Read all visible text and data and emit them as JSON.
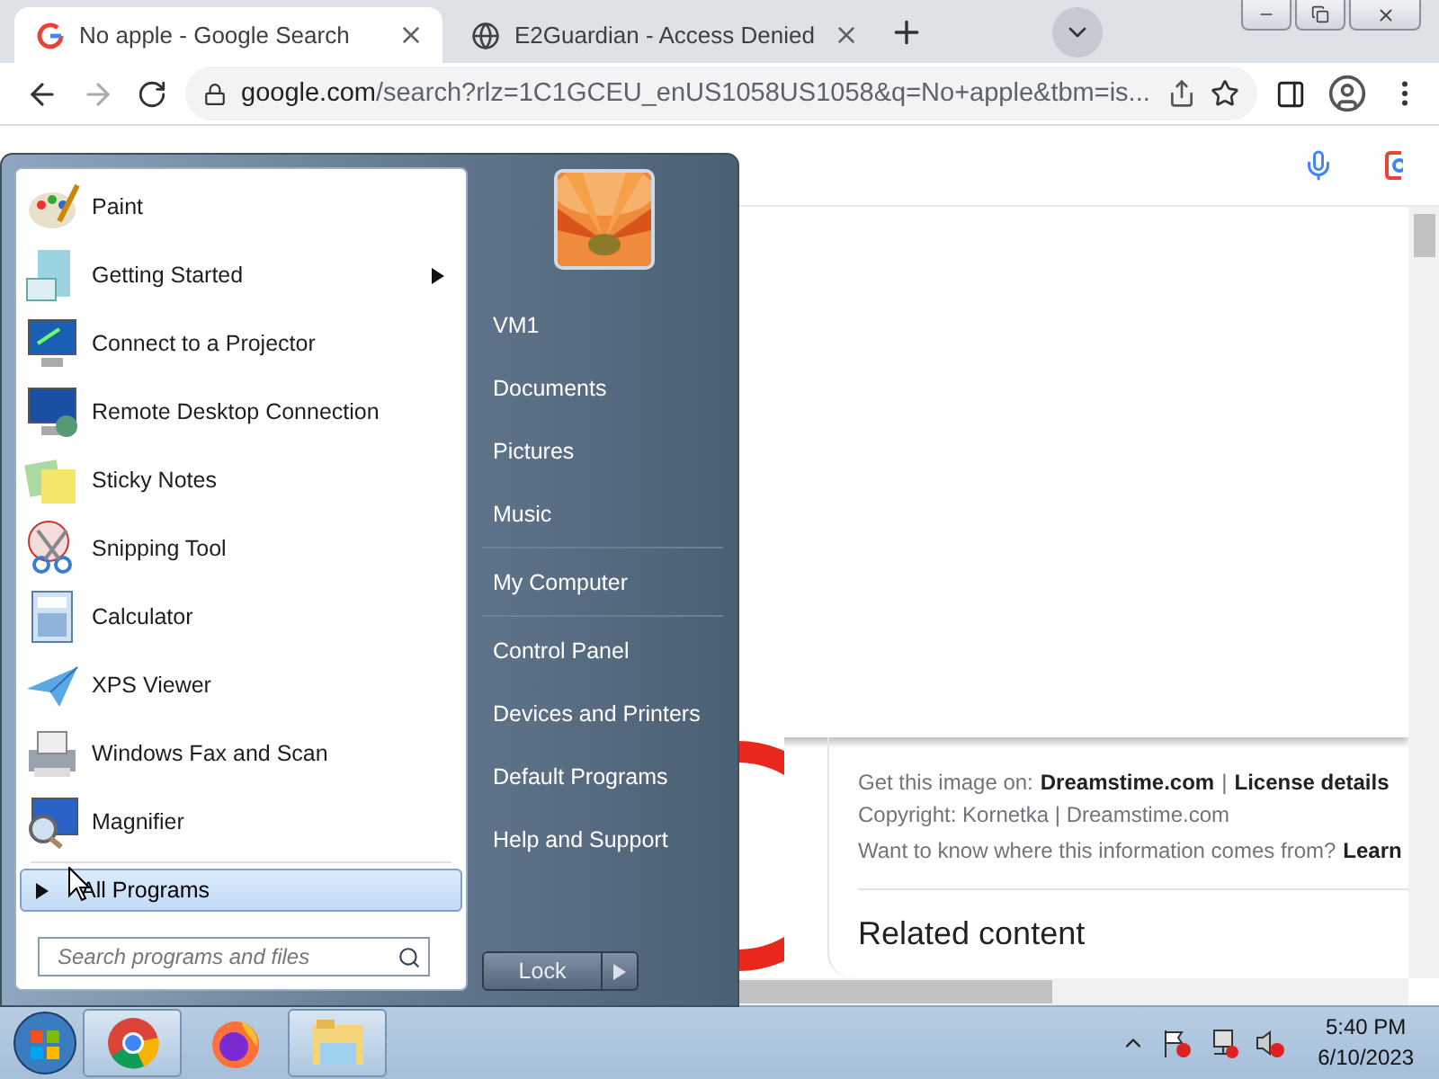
{
  "browser": {
    "tabs": [
      {
        "title": "No apple - Google Search",
        "selected": true
      },
      {
        "title": "E2Guardian - Access Denied",
        "selected": false
      }
    ],
    "address": {
      "host": "google.com",
      "path": "/search?rlz=1C1GCEU_enUS1058US1058&q=No+apple&tbm=is..."
    }
  },
  "result": {
    "attribution": {
      "label": "Get this image on:",
      "source_link": "Dreamstime.com",
      "separator": "|",
      "license_link": "License details"
    },
    "copyright": "Copyright: Kornetka | Dreamstime.com",
    "info": {
      "question": "Want to know where this information comes from?",
      "link": "Learn"
    },
    "related_heading": "Related content"
  },
  "start_menu": {
    "programs": [
      {
        "label": "Paint",
        "has_submenu": false
      },
      {
        "label": "Getting Started",
        "has_submenu": true
      },
      {
        "label": "Connect to a Projector",
        "has_submenu": false
      },
      {
        "label": "Remote Desktop Connection",
        "has_submenu": false
      },
      {
        "label": "Sticky Notes",
        "has_submenu": false
      },
      {
        "label": "Snipping Tool",
        "has_submenu": false
      },
      {
        "label": "Calculator",
        "has_submenu": false
      },
      {
        "label": "XPS Viewer",
        "has_submenu": false
      },
      {
        "label": "Windows Fax and Scan",
        "has_submenu": false
      },
      {
        "label": "Magnifier",
        "has_submenu": false
      }
    ],
    "all_programs": {
      "label": "All Programs",
      "selected": true
    },
    "search": {
      "placeholder": "Search programs and files"
    },
    "places": [
      {
        "label": "VM1",
        "separator_before": false
      },
      {
        "label": "Documents",
        "separator_before": false
      },
      {
        "label": "Pictures",
        "separator_before": false
      },
      {
        "label": "Music",
        "separator_before": false
      },
      {
        "label": "My Computer",
        "separator_before": true
      },
      {
        "label": "Control Panel",
        "separator_before": true
      },
      {
        "label": "Devices and Printers",
        "separator_before": false
      },
      {
        "label": "Default Programs",
        "separator_before": false
      },
      {
        "label": "Help and Support",
        "separator_before": false
      }
    ],
    "shutdown": {
      "label": "Lock"
    }
  },
  "taskbar": {
    "apps": [
      {
        "running": true
      },
      {
        "running": false
      },
      {
        "running": true
      }
    ],
    "clock": {
      "time": "5:40 PM",
      "date": "6/10/2023"
    }
  }
}
